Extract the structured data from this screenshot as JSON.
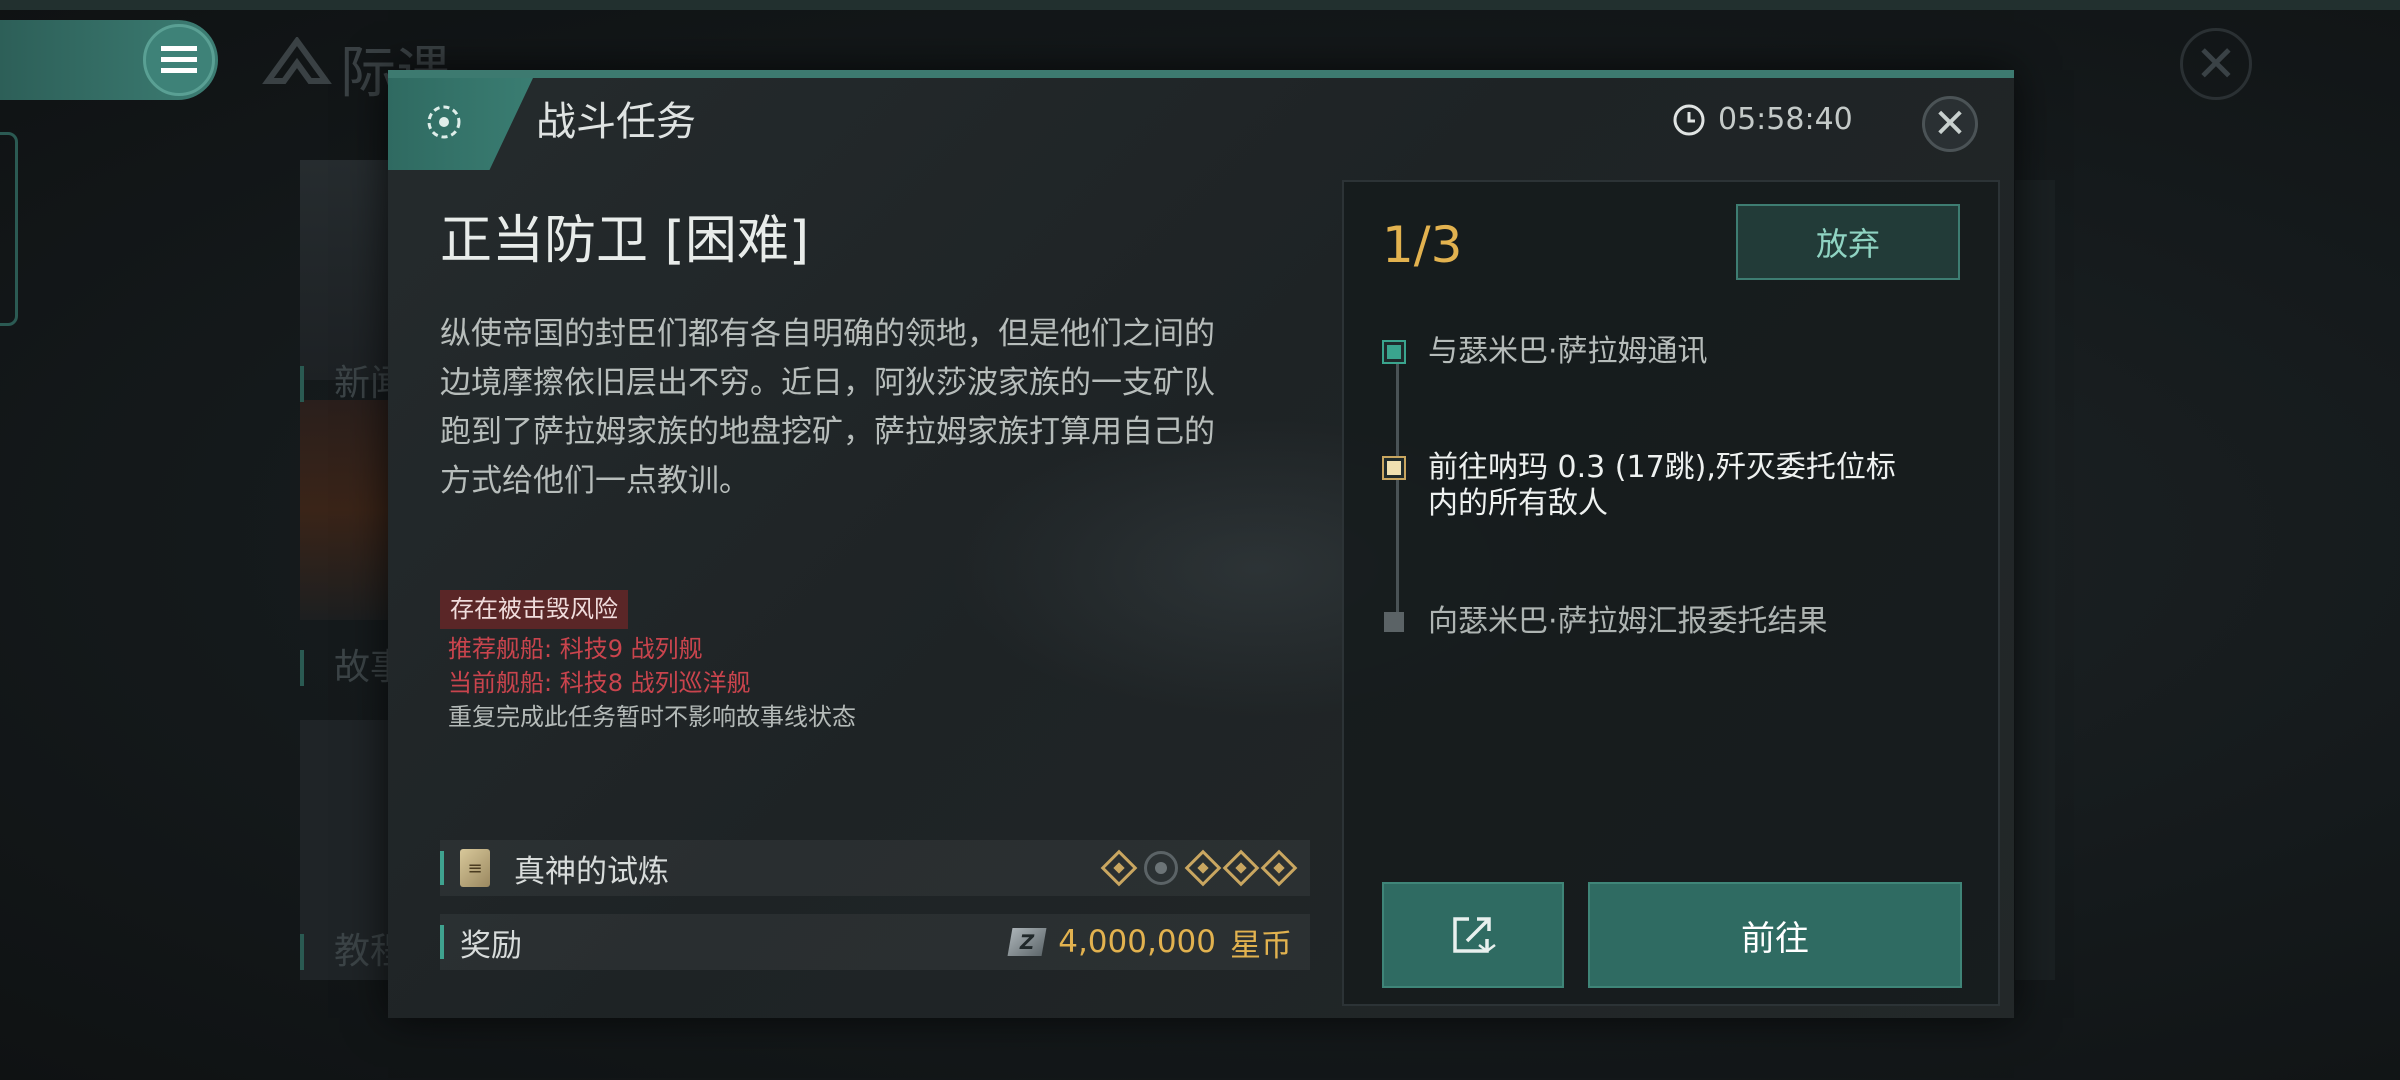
{
  "background": {
    "logo_text": "际遇",
    "side_labels": [
      "新闻",
      "故事",
      "教程"
    ]
  },
  "dialog": {
    "title": "战斗任务",
    "timer": "05:58:40",
    "mission_name": "正当防卫 [困难]",
    "description": "纵使帝国的封臣们都有各自明确的领地，但是他们之间的边境摩擦依旧层出不穷。近日，阿狄莎波家族的一支矿队跑到了萨拉姆家族的地盘挖矿，萨拉姆家族打算用自己的方式给他们一点教训。",
    "risk_badge": "存在被击毁风险",
    "recommended_ship": "推荐舰船: 科技9 战列舰",
    "current_ship": "当前舰船: 科技8 战列巡洋舰",
    "repeat_note": "重复完成此任务暂时不影响故事线状态",
    "storyline": {
      "label": "真神的试炼",
      "total_stages": 5,
      "current_stage": 2
    },
    "reward": {
      "label": "奖励",
      "amount": "4,000,000",
      "unit": "星币"
    }
  },
  "objectives": {
    "progress": "1/3",
    "abandon_label": "放弃",
    "steps": [
      {
        "text": "与瑟米巴·萨拉姆通讯",
        "status": "done"
      },
      {
        "text": "前往呐玛 0.3 (17跳),歼灭委托位标内的所有敌人",
        "status": "current"
      },
      {
        "text": "向瑟米巴·萨拉姆汇报委托结果",
        "status": "pending"
      }
    ],
    "go_label": "前往"
  },
  "colors": {
    "accent": "#3d7a70",
    "gold": "#e2b24f",
    "danger": "#c9444d"
  }
}
